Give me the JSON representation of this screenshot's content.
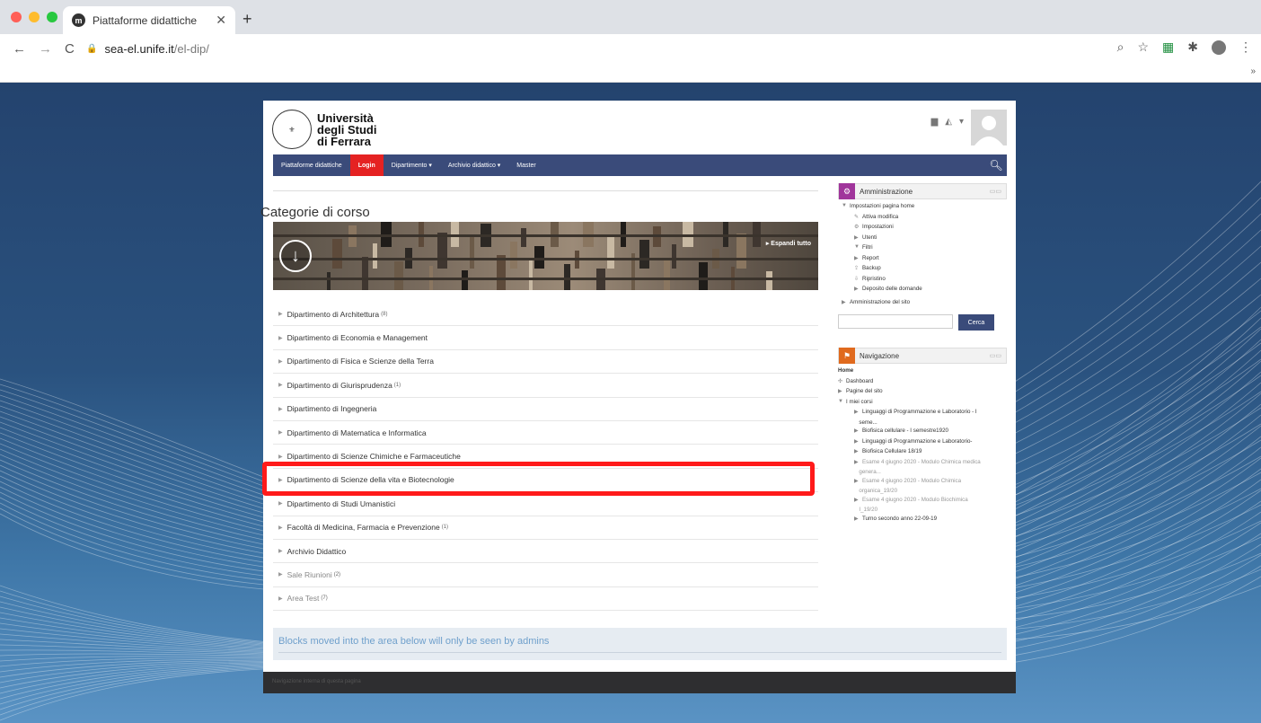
{
  "browser": {
    "tab_title": "Piattaforme didattiche",
    "tab_favicon": "m",
    "url_host": "sea-el.unife.it",
    "url_path": "/el-dip/",
    "bookmarks_more": "»"
  },
  "site": {
    "logo_line1": "Università",
    "logo_line2": "degli Studi",
    "logo_line3": "di Ferrara"
  },
  "navbar": {
    "items": [
      "Piattaforme didattiche",
      "Login",
      "Dipartimento ▾",
      "Archivio didattico ▾",
      "Master"
    ]
  },
  "main": {
    "title": "Categorie di corso",
    "expand_all": "▸ Espandi tutto",
    "categories": [
      {
        "label": "Dipartimento di Architettura",
        "count": "(8)"
      },
      {
        "label": "Dipartimento di Economia e Management",
        "count": ""
      },
      {
        "label": "Dipartimento di Fisica e Scienze della Terra",
        "count": ""
      },
      {
        "label": "Dipartimento di Giurisprudenza",
        "count": "(1)"
      },
      {
        "label": "Dipartimento di Ingegneria",
        "count": ""
      },
      {
        "label": "Dipartimento di Matematica e Informatica",
        "count": ""
      },
      {
        "label": "Dipartimento di Scienze Chimiche e Farmaceutiche",
        "count": ""
      },
      {
        "label": "Dipartimento di Scienze della vita e Biotecnologie",
        "count": ""
      },
      {
        "label": "Dipartimento di Studi Umanistici",
        "count": ""
      },
      {
        "label": "Facoltà di Medicina, Farmacia e Prevenzione",
        "count": "(1)"
      },
      {
        "label": "Archivio Didattico",
        "count": ""
      },
      {
        "label": "Sale Riunioni",
        "count": "(2)"
      },
      {
        "label": "Area Test",
        "count": "(7)"
      }
    ],
    "blocks_notice": "Blocks moved into the area below will only be seen by admins",
    "footer_text": "Navigazione interna di questa pagina"
  },
  "admin_block": {
    "title": "Amministrazione",
    "items": [
      "Impostazioni pagina home",
      "Attiva modifica",
      "Impostazioni",
      "Utenti",
      "Filtri",
      "Report",
      "Backup",
      "Ripristino",
      "Deposito delle domande",
      "Amministrazione del sito"
    ],
    "search_button": "Cerca"
  },
  "nav_block": {
    "title": "Navigazione",
    "items": [
      "Home",
      "Dashboard",
      "Pagine del sito",
      "I miei corsi",
      "Linguaggi di Programmazione e Laboratorio - I",
      "seme...",
      "Biofisica cellulare - I semestre1920",
      "Linguaggi di Programmazione e Laboratorio-",
      "Biofisica Cellulare 18/19",
      "Esame 4 giugno 2020 - Modulo Chimica medica",
      "genera...",
      "Esame 4 giugno 2020 - Modulo Chimica",
      "organica_19/20",
      "Esame 4 giugno 2020 - Modulo Biochimica",
      "I_19/20",
      "Turno secondo anno 22-09-19"
    ]
  },
  "colors": {
    "navbar": "#3a4b7a",
    "login_active": "#e52222",
    "highlight": "#ff1a1a",
    "admin_icon": "#a0359b",
    "nav_icon": "#e06a1e"
  }
}
